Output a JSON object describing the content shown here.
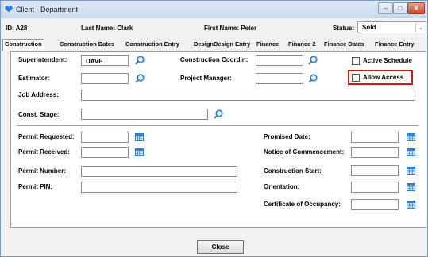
{
  "window": {
    "title": "Client - Department",
    "minimize_glyph": "–",
    "maximize_glyph": "□",
    "close_glyph": "✕"
  },
  "header": {
    "id_text": "ID: A28",
    "last_name_text": "Last Name: Clark",
    "first_name_text": "First Name: Peter",
    "status_label": "Status:",
    "status_value": "Sold"
  },
  "tabs": [
    {
      "label": "Construction",
      "active": true
    },
    {
      "label": "Construction Dates"
    },
    {
      "label": "Construction Entry"
    },
    {
      "label": "Design"
    },
    {
      "label": "Design Entry"
    },
    {
      "label": "Finance"
    },
    {
      "label": "Finance 2"
    },
    {
      "label": "Finance Dates"
    },
    {
      "label": "Finance Entry"
    }
  ],
  "form": {
    "superintendent_label": "Superintendent:",
    "superintendent_value": "DAVE",
    "estimator_label": "Estimator:",
    "estimator_value": "",
    "construction_coordin_label": "Construction Coordin:",
    "project_manager_label": "Project Manager:",
    "active_schedule_label": "Active Schedule",
    "allow_access_label": "Allow Access",
    "job_address_label": "Job Address:",
    "const_stage_label": "Const. Stage:",
    "permit_requested_label": "Permit Requested:",
    "permit_received_label": "Permit Received:",
    "permit_number_label": "Permit Number:",
    "permit_pin_label": "Permit PIN:",
    "promised_date_label": "Promised Date:",
    "notice_label": "Notice of Commencement:",
    "construction_start_label": "Construction Start:",
    "orientation_label": "Orientation:",
    "certificate_label": "Certificate of Occupancy:"
  },
  "footer": {
    "close_label": "Close"
  },
  "colors": {
    "highlight": "#e01010",
    "icon_blue": "#2a7fd4"
  }
}
